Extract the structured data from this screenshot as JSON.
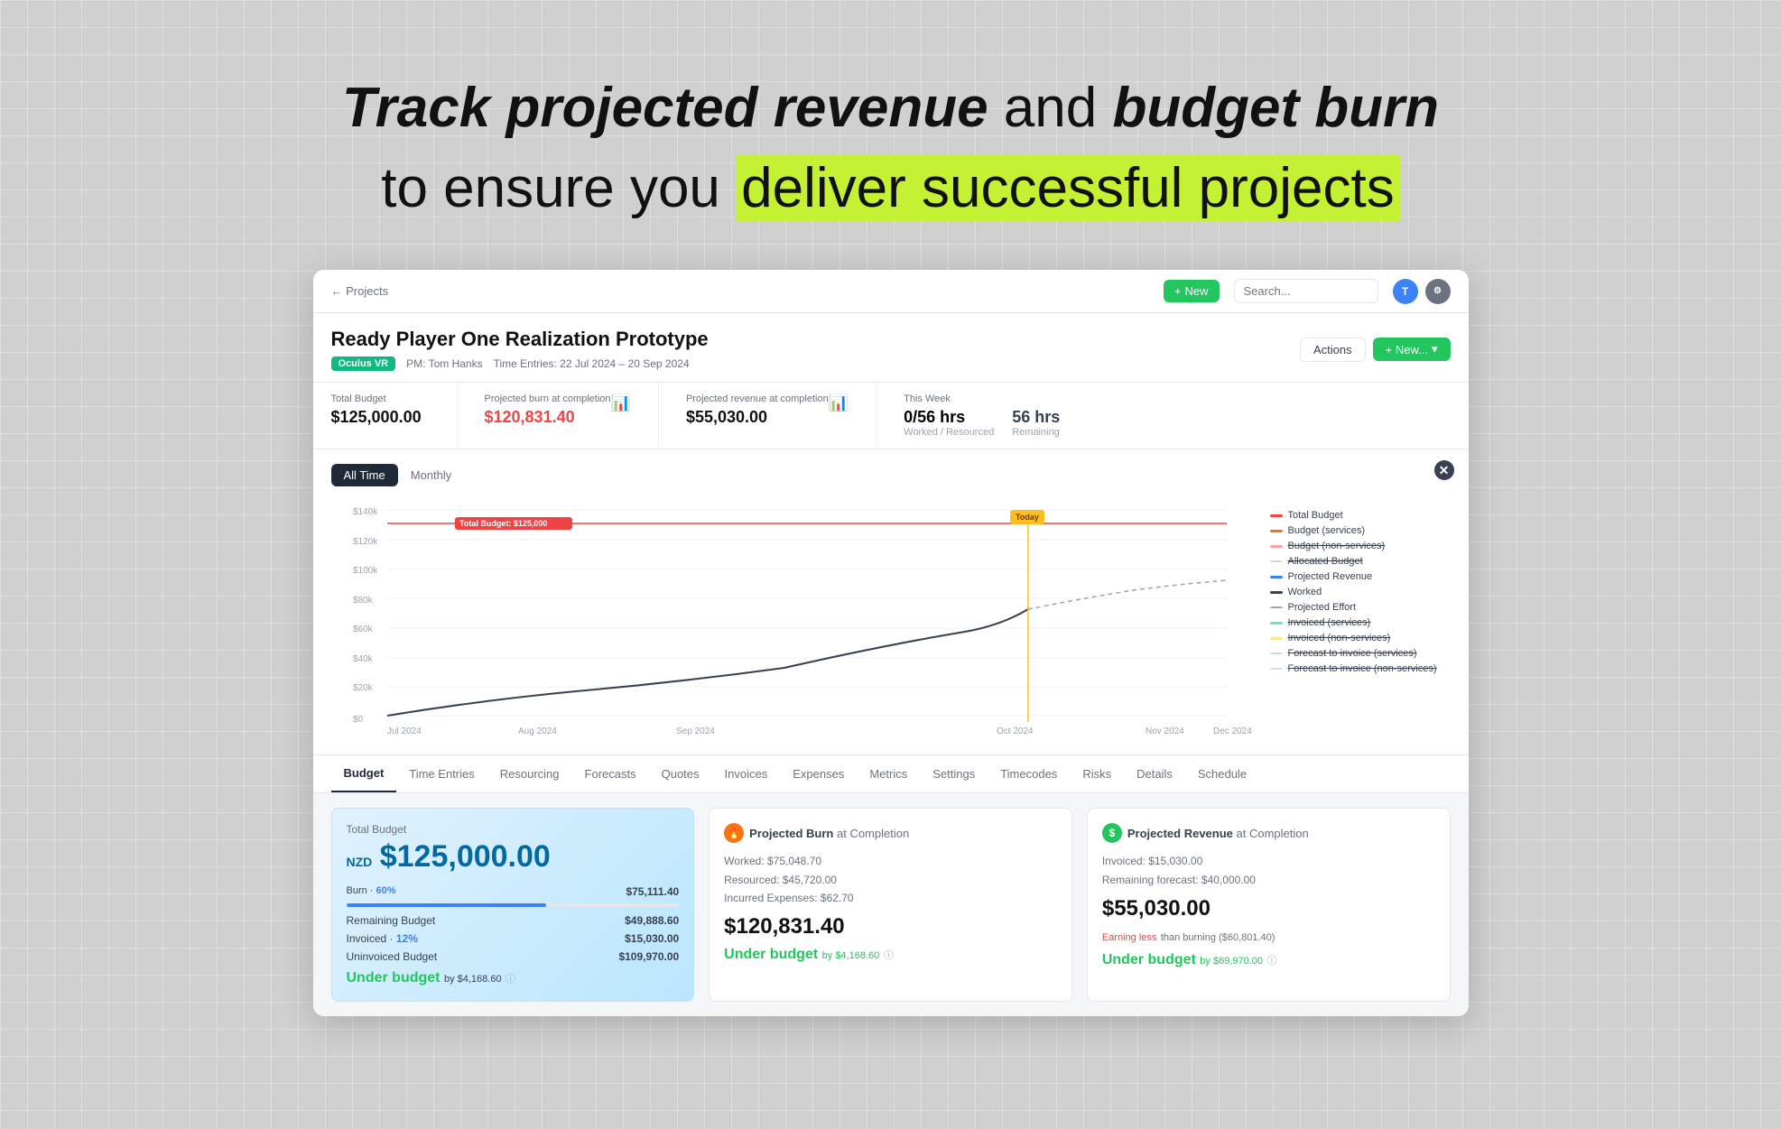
{
  "hero": {
    "line1_plain": " and ",
    "line1_italic1": "Track projected revenue",
    "line1_italic2": "budget burn",
    "line2_prefix": "to ensure you ",
    "line2_highlight": "deliver successful projects"
  },
  "nav": {
    "breadcrumb_link": "← Projects",
    "new_btn": "+ New",
    "search_placeholder": "Search...",
    "new_label": "+ New..."
  },
  "project": {
    "title": "Ready Player One Realization Prototype",
    "tag": "Oculus VR",
    "pm": "PM: Tom Hanks",
    "time_entries": "Time Entries: 22 Jul 2024 – 20 Sep 2024",
    "actions_btn": "Actions",
    "new_btn": "+ New..."
  },
  "stats": [
    {
      "label": "Total Budget",
      "value": "$125,000.00",
      "sub": ""
    },
    {
      "label": "Projected burn at completion",
      "value": "$120,831.40",
      "sub": ""
    },
    {
      "label": "Projected revenue at completion",
      "value": "$55,030.00",
      "sub": ""
    }
  ],
  "this_week": {
    "label": "This Week",
    "worked": "0/56 hrs",
    "worked_label": "Worked / Resourced",
    "remaining": "56 hrs",
    "remaining_label": "Remaining"
  },
  "chart": {
    "tabs": [
      "All Time",
      "Monthly"
    ],
    "active_tab": "All Time",
    "x_labels": [
      "Jul 2024",
      "Aug 2024",
      "Sep 2024",
      "Oct 2024",
      "Nov 2024",
      "Dec 2024"
    ],
    "y_labels": [
      "$0",
      "$20k",
      "$40k",
      "$60k",
      "$80k",
      "$100k",
      "$120k",
      "$140k"
    ],
    "total_budget_label": "Total Budget: $125,000",
    "today_label": "Today",
    "legend": [
      {
        "color": "#ef4444",
        "label": "Total Budget",
        "style": "solid"
      },
      {
        "color": "#f97316",
        "label": "Budget (services)",
        "style": "solid"
      },
      {
        "color": "#fca5a5",
        "label": "Budget (non-services)",
        "style": "solid"
      },
      {
        "color": "#d1d5db",
        "label": "Allocated Budget",
        "style": "dashed"
      },
      {
        "color": "#3b82f6",
        "label": "Projected Revenue",
        "style": "solid"
      },
      {
        "color": "#374151",
        "label": "Worked",
        "style": "solid"
      },
      {
        "color": "#9ca3af",
        "label": "Projected Effort",
        "style": "dashed"
      },
      {
        "color": "#6ee7b7",
        "label": "Invoiced (services)",
        "style": "solid"
      },
      {
        "color": "#fde68a",
        "label": "Invoiced (non-services)",
        "style": "solid"
      },
      {
        "color": "#bfdbfe",
        "label": "Forecast to invoice (services)",
        "style": "dashed"
      },
      {
        "color": "#ddd6fe",
        "label": "Forecast to invoice (non-services)",
        "style": "dashed"
      }
    ]
  },
  "tabs": {
    "items": [
      "Budget",
      "Time Entries",
      "Resourcing",
      "Forecasts",
      "Quotes",
      "Invoices",
      "Expenses",
      "Metrics",
      "Settings",
      "Timecodes",
      "Risks",
      "Details",
      "Schedule"
    ],
    "active": "Budget"
  },
  "budget_section": {
    "total_budget_label": "Total Budget",
    "currency": "NZD",
    "amount": "$125,000.00",
    "burn_label": "Burn",
    "burn_pct": "60%",
    "burn_value": "$75,111.40",
    "burn_progress": 60,
    "remaining_label": "Remaining Budget",
    "remaining_value": "$49,888.60",
    "invoiced_label": "Invoiced",
    "invoiced_pct": "12%",
    "invoiced_value": "$15,030.00",
    "uninvoiced_label": "Uninvoiced Budget",
    "uninvoiced_value": "$109,970.00",
    "under_budget_label": "Under budget",
    "under_budget_value": "by $4,168.60"
  },
  "projected_burn": {
    "section_label": "Projected Burn",
    "at_completion": "at Completion",
    "worked": "Worked: $75,048.70",
    "resourced": "Resourced: $45,720.00",
    "expenses": "Incurred Expenses: $62.70",
    "total": "$120,831.40",
    "under_budget": "Under budget",
    "under_value": "by $4,168.60"
  },
  "projected_revenue": {
    "section_label": "Projected Revenue",
    "at_completion": "at Completion",
    "invoiced": "Invoiced: $15,030.00",
    "remaining_forecast": "Remaining forecast: $40,000.00",
    "total": "$55,030.00",
    "earning_less": "Earning less",
    "earning_less_detail": "than burning ($60,801.40)",
    "under_budget": "Under budget",
    "under_value": "by $69,970.00"
  }
}
